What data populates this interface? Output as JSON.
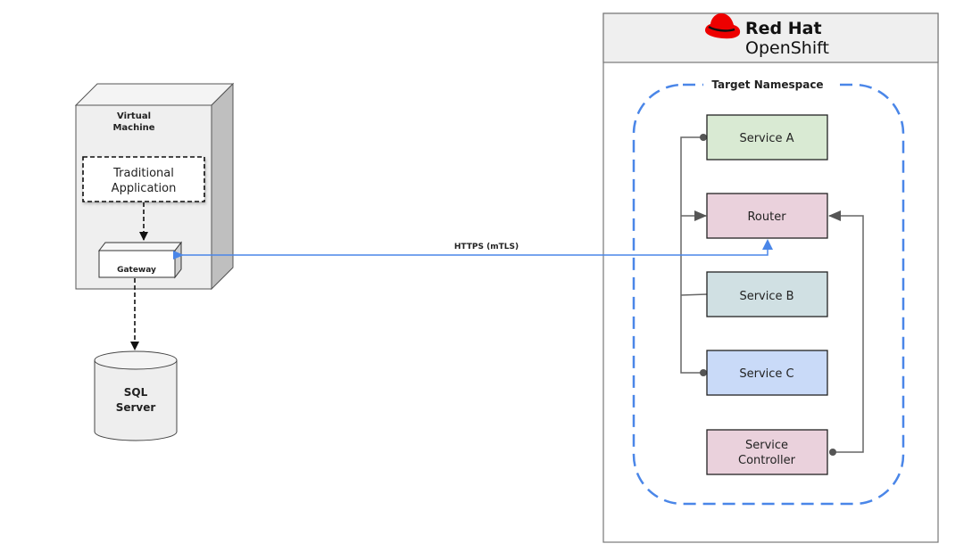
{
  "colors": {
    "accent_blue": "#4a86e8",
    "connector_gray": "#666666",
    "redhat_red": "#ee0000",
    "service_a_fill": "#d9ead3",
    "router_fill": "#ead1dc",
    "service_b_fill": "#d0e0e3",
    "service_c_fill": "#c9daf8",
    "controller_fill": "#ead1dc",
    "vm_fill": "#efefef"
  },
  "vm": {
    "title_line1": "Virtual",
    "title_line2": "Machine",
    "app_line1": "Traditional",
    "app_line2": "Application",
    "gateway": "Gateway"
  },
  "database": {
    "line1": "SQL",
    "line2": "Server"
  },
  "connection": {
    "label": "HTTPS (mTLS)"
  },
  "openshift": {
    "brand_line1": "Red Hat",
    "brand_line2": "OpenShift",
    "logo_icon": "redhat-fedora-icon",
    "namespace_label": "Target Namespace",
    "services": [
      {
        "label": "Service A"
      },
      {
        "label": "Router"
      },
      {
        "label": "Service B"
      },
      {
        "label": "Service C"
      },
      {
        "label_line1": "Service",
        "label_line2": "Controller"
      }
    ]
  }
}
